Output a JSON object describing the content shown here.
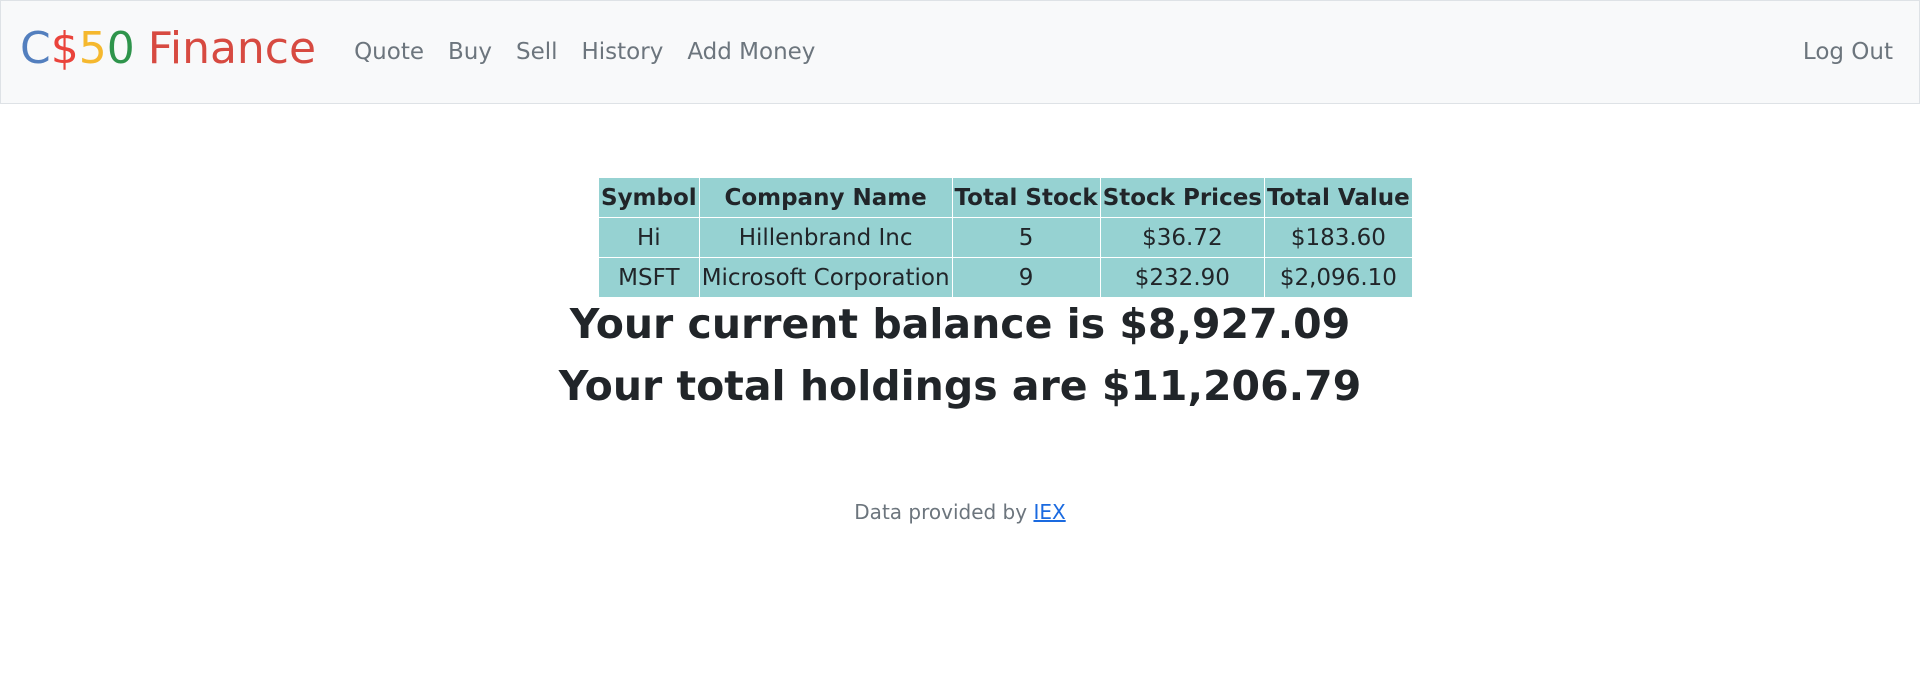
{
  "brand": {
    "c": "C",
    "dollar": "$",
    "five": "5",
    "zero": "0",
    "finance": "Finance"
  },
  "nav": {
    "links": [
      "Quote",
      "Buy",
      "Sell",
      "History",
      "Add Money"
    ],
    "logout": "Log Out"
  },
  "table": {
    "headers": [
      "Symbol",
      "Company Name",
      "Total Stock",
      "Stock Prices",
      "Total Value"
    ],
    "rows": [
      [
        "Hi",
        "Hillenbrand Inc",
        "5",
        "$36.72",
        "$183.60"
      ],
      [
        "MSFT",
        "Microsoft Corporation",
        "9",
        "$232.90",
        "$2,096.10"
      ]
    ]
  },
  "summary": {
    "balance": "Your current balance is $8,927.09",
    "holdings": "Your total holdings are $11,206.79"
  },
  "footer": {
    "prefix": "Data provided by ",
    "link": "IEX"
  },
  "colors": {
    "brand_blue": "#537fbe",
    "brand_red": "#ea433b",
    "brand_yellow": "#f5b82e",
    "brand_green": "#2e944b",
    "table_bg": "#96d2d2",
    "link": "#1a6ae0"
  }
}
